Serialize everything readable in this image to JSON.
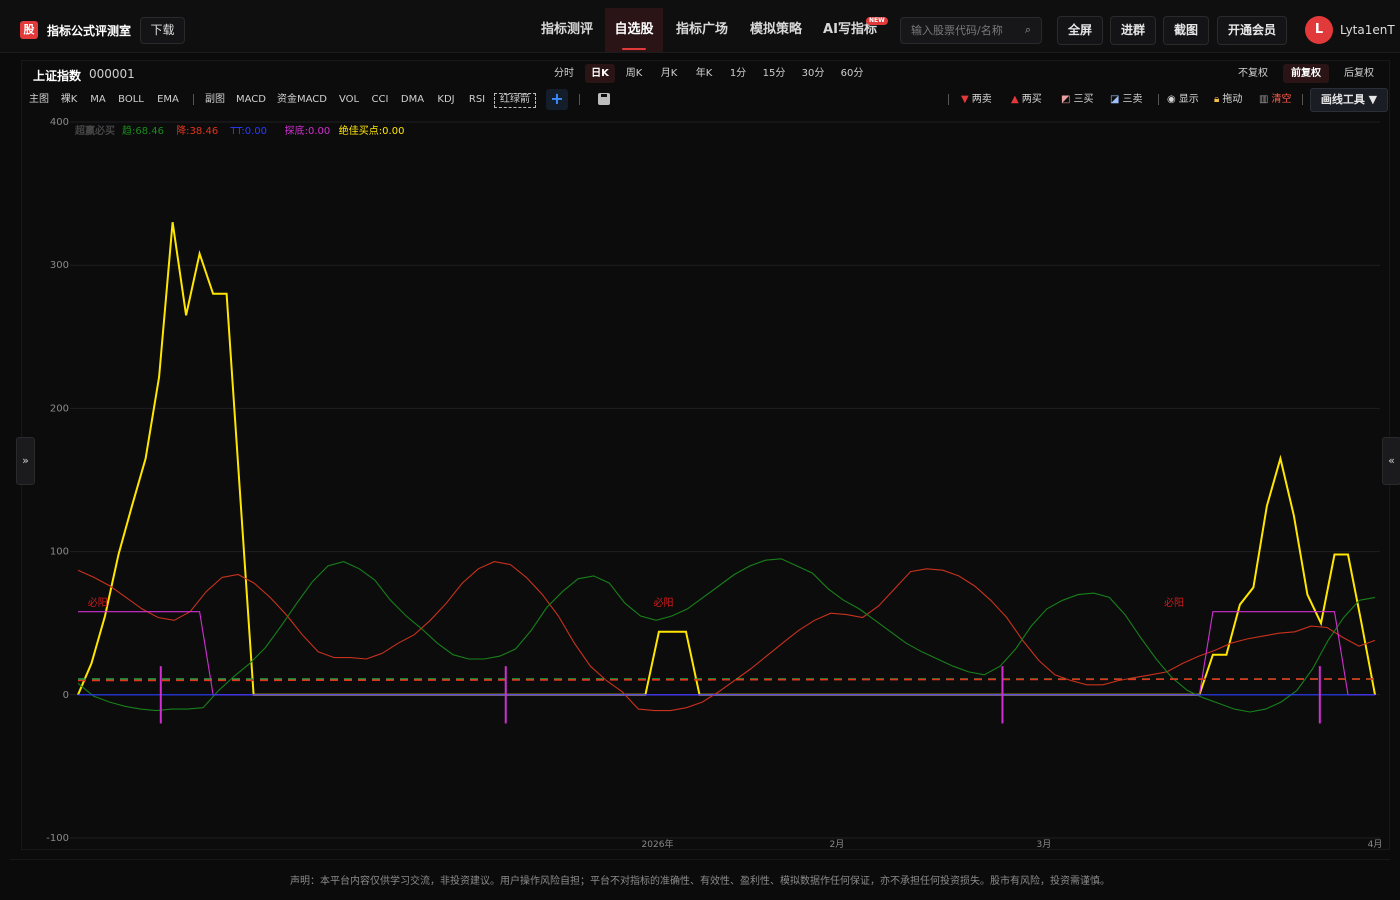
{
  "app": {
    "logo": "股",
    "brand": "指标公式评测室",
    "download": "下载"
  },
  "nav": [
    "指标测评",
    "自选股",
    "指标广场",
    "模拟策略",
    "AI写指标"
  ],
  "nav_new_badge": "NEW",
  "search": {
    "placeholder": "输入股票代码/名称",
    "icon": "search-icon"
  },
  "top_buttons": [
    "全屏",
    "进群",
    "截图",
    "开通会员"
  ],
  "user": {
    "initial": "L",
    "name": "Lyta1enT"
  },
  "stock": {
    "name": "上证指数",
    "code": "000001"
  },
  "periods": [
    "分时",
    "日K",
    "周K",
    "月K",
    "年K",
    "1分",
    "15分",
    "30分",
    "60分"
  ],
  "active_period": "日K",
  "adjust": [
    "不复权",
    "前复权",
    "后复权"
  ],
  "active_adjust": "前复权",
  "indicators": [
    "主图",
    "裸K",
    "MA",
    "BOLL",
    "EMA",
    "副图",
    "MACD",
    "资金MACD",
    "VOL",
    "CCI",
    "DMA",
    "KDJ",
    "RSI",
    "红绿箭"
  ],
  "controls": {
    "two_sell": "两卖",
    "two_buy": "两买",
    "three_buy": "三买",
    "three_sell": "三卖",
    "show": "显示",
    "drag": "拖动",
    "clear": "清空",
    "draw_tools": "画线工具 ▼"
  },
  "side_toggles": {
    "left": "»",
    "right": "«"
  },
  "chart_data": {
    "type": "line",
    "title": "超赢必买",
    "legend": [
      {
        "label": "趋:68.46",
        "color": "#1a8a1a"
      },
      {
        "label": "降:38.46",
        "color": "#e0341c"
      },
      {
        "label": "TT:0.00",
        "color": "#2a3cff"
      },
      {
        "label": "探底:0.00",
        "color": "#d12fd1"
      },
      {
        "label": "绝佳买点:0.00",
        "color": "#ffe600"
      }
    ],
    "y_ticks": [
      400,
      300,
      200,
      100,
      0,
      -100
    ],
    "ylim": [
      -100,
      400
    ],
    "x_ticks": [
      "2026年",
      "2月",
      "3月",
      "4月"
    ],
    "x_tick_index": [
      42,
      55,
      70,
      94
    ],
    "n": 94,
    "annotation_label": "必阳",
    "annotation_index": [
      1,
      42,
      79
    ],
    "series": [
      {
        "name": "绝佳买点",
        "color": "#ffe600",
        "values": [
          0,
          22,
          55,
          98,
          132,
          165,
          222,
          330,
          265,
          308,
          280,
          280,
          140,
          0,
          0,
          0,
          0,
          0,
          0,
          0,
          0,
          0,
          0,
          0,
          0,
          0,
          0,
          0,
          0,
          0,
          0,
          0,
          0,
          0,
          0,
          0,
          0,
          0,
          0,
          0,
          0,
          0,
          0,
          44,
          44,
          44,
          0,
          0,
          0,
          0,
          0,
          0,
          0,
          0,
          0,
          0,
          0,
          0,
          0,
          0,
          0,
          0,
          0,
          0,
          0,
          0,
          0,
          0,
          0,
          0,
          0,
          0,
          0,
          0,
          0,
          0,
          0,
          0,
          0,
          0,
          0,
          0,
          0,
          0,
          28,
          28,
          63,
          75,
          132,
          165,
          125,
          70,
          50,
          98,
          98,
          50,
          0
        ]
      },
      {
        "name": "降",
        "color": "#c8321c",
        "values": [
          87,
          82,
          76,
          68,
          60,
          54,
          52,
          58,
          72,
          82,
          84,
          78,
          68,
          56,
          42,
          30,
          26,
          26,
          25,
          29,
          36,
          42,
          52,
          64,
          78,
          88,
          93,
          91,
          82,
          70,
          55,
          36,
          20,
          10,
          2,
          -10,
          -11,
          -11,
          -9,
          -5,
          2,
          10,
          18,
          27,
          36,
          45,
          52,
          57,
          56,
          54,
          62,
          74,
          86,
          88,
          87,
          83,
          76,
          66,
          54,
          38,
          24,
          14,
          10,
          7,
          7,
          10,
          12,
          14,
          16,
          22,
          27,
          31,
          36,
          39,
          41,
          43,
          44,
          48,
          47,
          40,
          34,
          38
        ]
      },
      {
        "name": "趋",
        "color": "#17801a",
        "values": [
          8,
          -1,
          -5,
          -8,
          -10,
          -11,
          -10,
          -10,
          -9,
          3,
          13,
          22,
          33,
          48,
          64,
          79,
          90,
          93,
          88,
          80,
          66,
          55,
          46,
          36,
          28,
          25,
          25,
          27,
          32,
          45,
          61,
          72,
          81,
          83,
          78,
          64,
          55,
          52,
          55,
          60,
          68,
          76,
          84,
          90,
          94,
          95,
          90,
          85,
          74,
          66,
          60,
          52,
          44,
          36,
          30,
          25,
          20,
          16,
          14,
          20,
          32,
          48,
          60,
          66,
          70,
          71,
          68,
          56,
          40,
          25,
          12,
          3,
          -2,
          -6,
          -10,
          -12,
          -10,
          -5,
          3,
          18,
          38,
          54,
          66,
          68
        ]
      },
      {
        "name": "探底",
        "color": "#d12fd1",
        "values": [
          58,
          58,
          58,
          58,
          58,
          58,
          58,
          58,
          58,
          58,
          0,
          0,
          0,
          0,
          0,
          0,
          0,
          0,
          0,
          0,
          0,
          0,
          0,
          0,
          0,
          0,
          0,
          0,
          0,
          0,
          0,
          0,
          0,
          0,
          0,
          0,
          0,
          0,
          0,
          0,
          0,
          0,
          0,
          0,
          0,
          0,
          0,
          0,
          0,
          0,
          0,
          0,
          0,
          0,
          0,
          0,
          0,
          0,
          0,
          0,
          0,
          0,
          0,
          0,
          0,
          0,
          0,
          0,
          0,
          0,
          0,
          0,
          0,
          0,
          0,
          0,
          0,
          0,
          0,
          0,
          0,
          0,
          0,
          0,
          58,
          58,
          58,
          58,
          58,
          58,
          58,
          58,
          58,
          58,
          0,
          0,
          0
        ]
      },
      {
        "name": "TT",
        "color": "#2a3cff",
        "values": [
          0,
          0
        ]
      },
      {
        "name": "ref_green",
        "color": "#1ea84a",
        "values": [
          11,
          11
        ]
      },
      {
        "name": "ref_red",
        "color": "#e0341c",
        "values": [
          10,
          11
        ]
      }
    ],
    "signal_marks_index": [
      6,
      31,
      67,
      90
    ],
    "signal_mark_color": "#d12fd1"
  },
  "footer": "声明：本平台内容仅供学习交流，非投资建议。用户操作风险自担；平台不对指标的准确性、有效性、盈利性、模拟数据作任何保证，亦不承担任何投资损失。股市有风险，投资需谨慎。"
}
